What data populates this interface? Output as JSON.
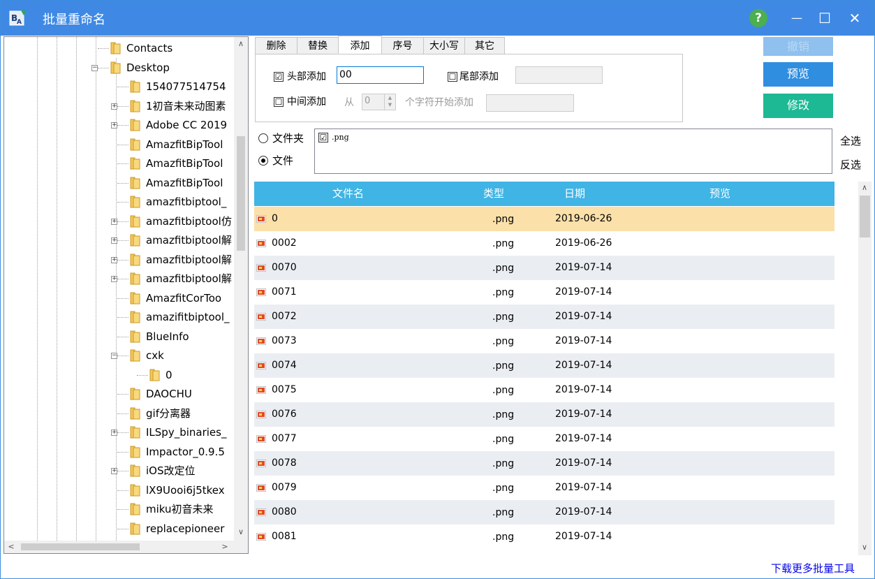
{
  "window": {
    "title": "批量重命名",
    "help": "?",
    "minimize": "—",
    "maximize": "☐",
    "close": "✕"
  },
  "tree": {
    "items": [
      {
        "label": "Contacts",
        "expander": ""
      },
      {
        "label": "Desktop",
        "expander": "−"
      },
      {
        "label": "154077514754",
        "expander": ""
      },
      {
        "label": "1初音未来动图素",
        "expander": "+"
      },
      {
        "label": "Adobe CC 2019",
        "expander": "+"
      },
      {
        "label": "AmazfitBipTool",
        "expander": ""
      },
      {
        "label": "AmazfitBipTool",
        "expander": ""
      },
      {
        "label": "AmazfitBipTool",
        "expander": ""
      },
      {
        "label": "amazfitbiptool_",
        "expander": ""
      },
      {
        "label": "amazfitbiptool仿",
        "expander": "+"
      },
      {
        "label": "amazfitbiptool解",
        "expander": "+"
      },
      {
        "label": "amazfitbiptool解",
        "expander": "+"
      },
      {
        "label": "amazfitbiptool解",
        "expander": "+"
      },
      {
        "label": "AmazfitCorToo",
        "expander": ""
      },
      {
        "label": "amazifitbiptool_",
        "expander": ""
      },
      {
        "label": "BlueInfo",
        "expander": ""
      },
      {
        "label": "cxk",
        "expander": "−"
      },
      {
        "label": "0",
        "expander": ""
      },
      {
        "label": "DAOCHU",
        "expander": ""
      },
      {
        "label": "gif分离器",
        "expander": ""
      },
      {
        "label": "ILSpy_binaries_",
        "expander": "+"
      },
      {
        "label": "Impactor_0.9.5",
        "expander": ""
      },
      {
        "label": "iOS改定位",
        "expander": "+"
      },
      {
        "label": "lX9Uooi6j5tkex",
        "expander": ""
      },
      {
        "label": "miku初音未来",
        "expander": ""
      },
      {
        "label": "replacepioneer",
        "expander": ""
      }
    ]
  },
  "tabs": [
    "删除",
    "替换",
    "添加",
    "序号",
    "大小写",
    "其它"
  ],
  "active_tab": "添加",
  "add_panel": {
    "head_add_label": "头部添加",
    "head_add_checked": "☑",
    "head_add_value": "00",
    "tail_add_label": "尾部添加",
    "tail_add_checked": "☐",
    "tail_add_value": "",
    "middle_add_label": "中间添加",
    "middle_add_checked": "☐",
    "from_label": "从",
    "position_value": "0",
    "position_suffix": "个字符开始添加",
    "middle_add_value": ""
  },
  "buttons": {
    "undo": "撤销",
    "preview": "预览",
    "modify": "修改"
  },
  "filter": {
    "folder_label": "文件夹",
    "file_label": "文件",
    "selected": "文件",
    "extensions": [
      {
        "checked": "☑",
        "label": ".png"
      }
    ],
    "select_all": "全选",
    "invert_select": "反选"
  },
  "grid": {
    "columns": [
      "文件名",
      "类型",
      "日期",
      "预览"
    ],
    "rows": [
      {
        "name": "0",
        "type": ".png",
        "date": "2019-06-26",
        "preview": ""
      },
      {
        "name": "0002",
        "type": ".png",
        "date": "2019-06-26",
        "preview": ""
      },
      {
        "name": "0070",
        "type": ".png",
        "date": "2019-07-14",
        "preview": ""
      },
      {
        "name": "0071",
        "type": ".png",
        "date": "2019-07-14",
        "preview": ""
      },
      {
        "name": "0072",
        "type": ".png",
        "date": "2019-07-14",
        "preview": ""
      },
      {
        "name": "0073",
        "type": ".png",
        "date": "2019-07-14",
        "preview": ""
      },
      {
        "name": "0074",
        "type": ".png",
        "date": "2019-07-14",
        "preview": ""
      },
      {
        "name": "0075",
        "type": ".png",
        "date": "2019-07-14",
        "preview": ""
      },
      {
        "name": "0076",
        "type": ".png",
        "date": "2019-07-14",
        "preview": ""
      },
      {
        "name": "0077",
        "type": ".png",
        "date": "2019-07-14",
        "preview": ""
      },
      {
        "name": "0078",
        "type": ".png",
        "date": "2019-07-14",
        "preview": ""
      },
      {
        "name": "0079",
        "type": ".png",
        "date": "2019-07-14",
        "preview": ""
      },
      {
        "name": "0080",
        "type": ".png",
        "date": "2019-07-14",
        "preview": ""
      },
      {
        "name": "0081",
        "type": ".png",
        "date": "2019-07-14",
        "preview": ""
      }
    ]
  },
  "footer": {
    "download_link": "下载更多批量工具"
  },
  "colors": {
    "titlebar": "#3f89e5",
    "grid_header": "#40b4e5",
    "selected_row": "#fbe0a9",
    "alt_row": "#eaeef2",
    "preview_button": "#2f8ee0",
    "modify_button": "#1db894",
    "undo_button": "#8fc0ee",
    "undo_text": "#b9d8f5"
  }
}
